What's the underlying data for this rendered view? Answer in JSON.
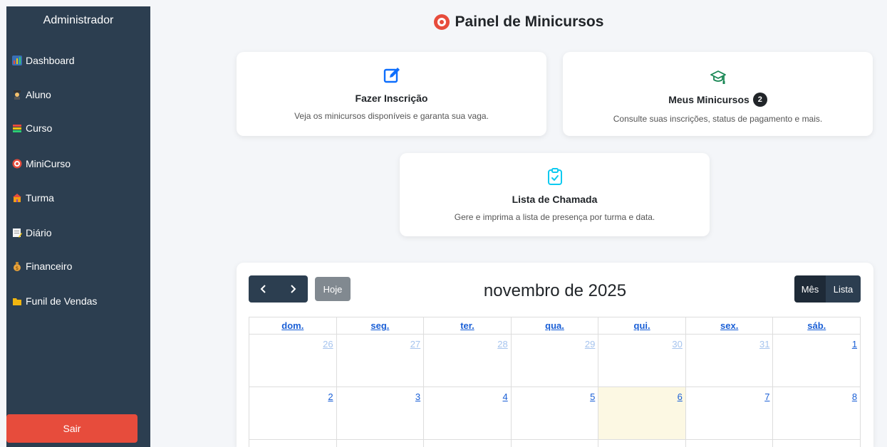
{
  "sidebar": {
    "title": "Administrador",
    "items": [
      {
        "label": "Dashboard",
        "icon": "bar-chart-icon"
      },
      {
        "label": "Aluno",
        "icon": "student-icon"
      },
      {
        "label": "Curso",
        "icon": "books-icon"
      },
      {
        "label": "MiniCurso",
        "icon": "target-icon"
      },
      {
        "label": "Turma",
        "icon": "school-icon"
      },
      {
        "label": "Diário",
        "icon": "memo-icon"
      },
      {
        "label": "Financeiro",
        "icon": "money-bag-icon"
      },
      {
        "label": "Funil de Vendas",
        "icon": "folder-icon"
      }
    ],
    "logout_label": "Sair"
  },
  "header": {
    "title": "Painel de Minicursos"
  },
  "cards": {
    "enroll": {
      "title": "Fazer Inscrição",
      "desc": "Veja os minicursos disponíveis e garanta sua vaga."
    },
    "my_courses": {
      "title": "Meus Minicursos",
      "badge": "2",
      "desc": "Consulte suas inscrições, status de pagamento e mais."
    },
    "attendance": {
      "title": "Lista de Chamada",
      "desc": "Gere e imprima a lista de presença por turma e data."
    }
  },
  "calendar": {
    "prev_label": "‹",
    "next_label": "›",
    "today_label": "Hoje",
    "title": "novembro de 2025",
    "view_month": "Mês",
    "view_list": "Lista",
    "weekdays": [
      "dom.",
      "seg.",
      "ter.",
      "qua.",
      "qui.",
      "sex.",
      "sáb."
    ],
    "week1": [
      "26",
      "27",
      "28",
      "29",
      "30",
      "31",
      "1"
    ],
    "week2": [
      "2",
      "3",
      "4",
      "5",
      "6",
      "7",
      "8"
    ]
  },
  "colors": {
    "sidebar_bg": "#2c3e50",
    "logout_bg": "#e74c3c",
    "link_blue": "#1a5fd6",
    "today_highlight": "#fcf8e3",
    "accent_green": "#198754",
    "accent_cyan": "#0dcaf0",
    "accent_blue": "#0d6efd"
  }
}
